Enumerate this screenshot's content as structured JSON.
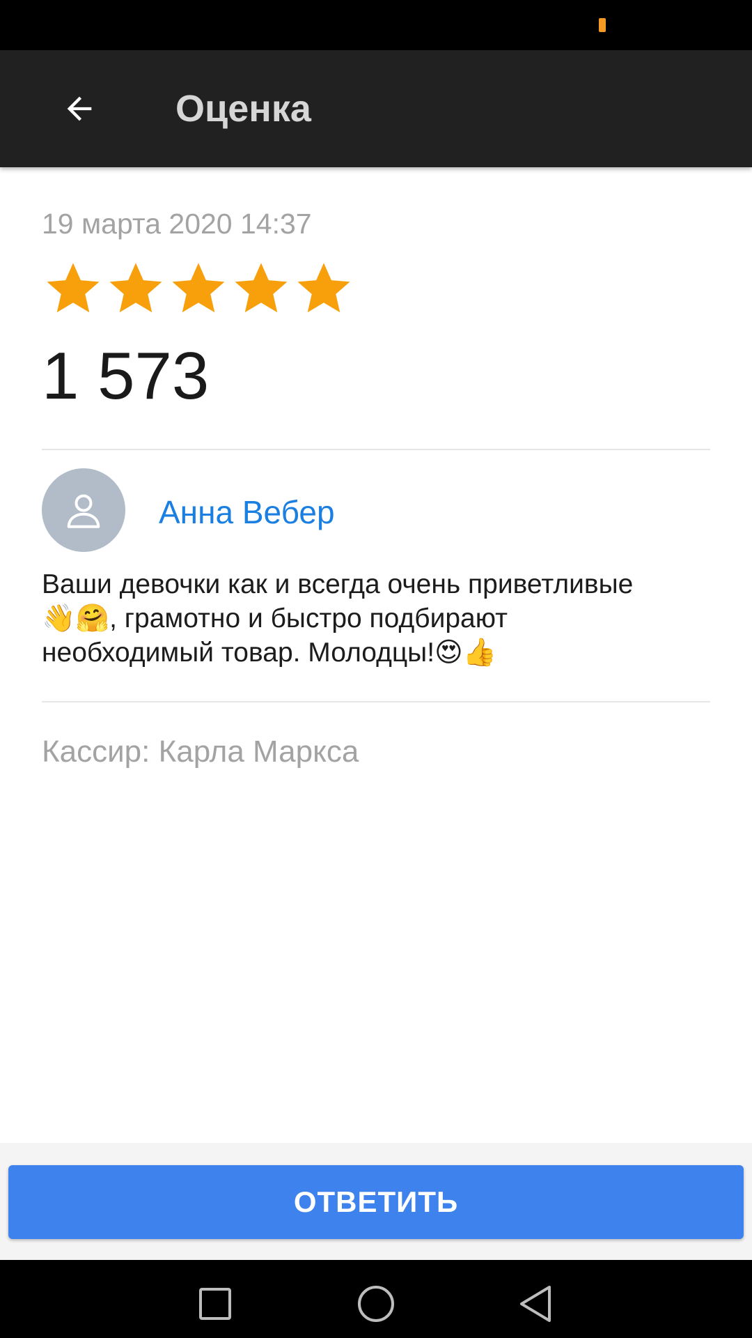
{
  "colors": {
    "accent_orange": "#f7a00c",
    "battery_orange": "#f59a23",
    "link_blue": "#1a7fe0",
    "button_blue": "#3d82ed",
    "app_bar": "#212121"
  },
  "app_bar": {
    "title": "Оценка",
    "back_icon": "arrow-left-icon"
  },
  "review": {
    "date": "19 марта 2020 14:37",
    "rating": 5,
    "rating_max": 5,
    "score": "1 573",
    "author": {
      "name": "Анна Вебер",
      "avatar_icon": "user-placeholder-icon"
    },
    "text_line1": "Ваши девочки как и всегда очень приветливые",
    "text_line2": "👋🤗, грамотно и быстро подбирают",
    "text_line3": "необходимый товар. Молодцы!😍👍",
    "cashier": "Кассир: Карла Маркса"
  },
  "actions": {
    "reply_label": "ОТВЕТИТЬ"
  },
  "nav": {
    "recents_icon": "square-icon",
    "home_icon": "circle-icon",
    "back_icon": "triangle-back-icon"
  }
}
